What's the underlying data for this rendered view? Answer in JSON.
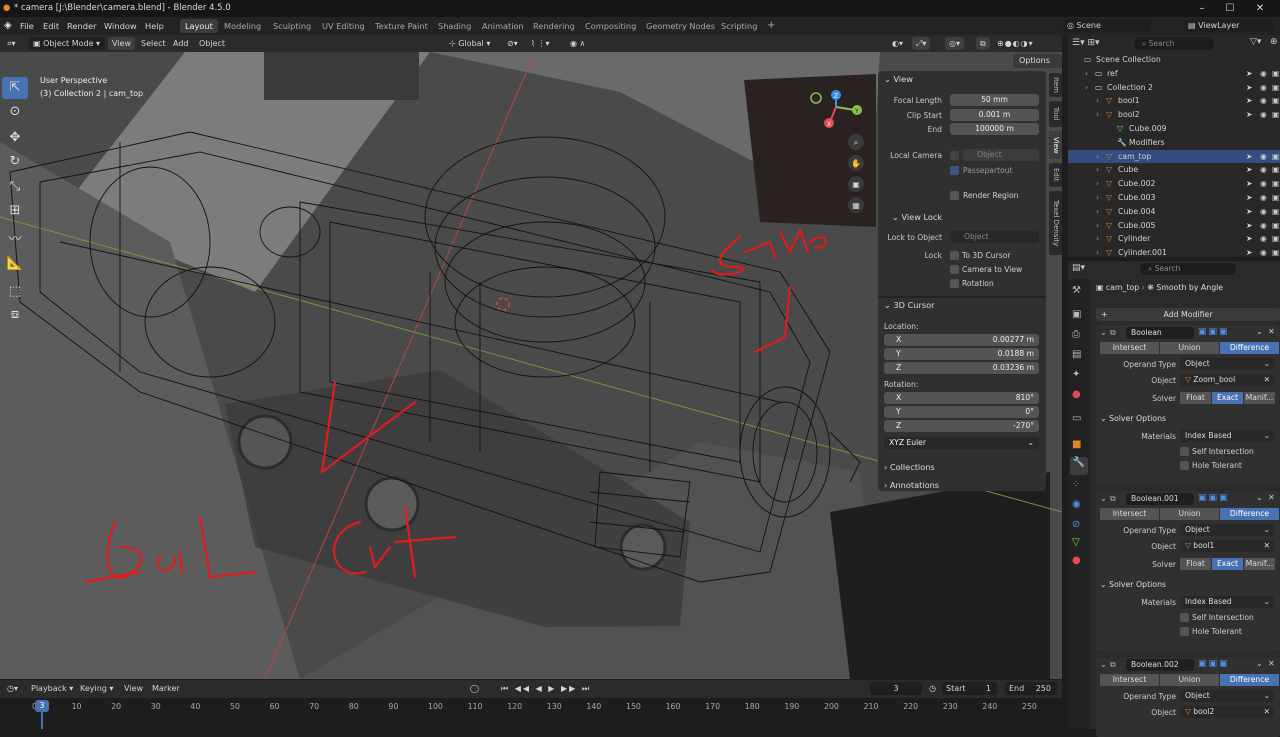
{
  "window": {
    "title": "* camera [J:\\Blender\\camera.blend] - Blender 4.5.0",
    "controls": [
      "–",
      "☐",
      "✕"
    ]
  },
  "menus": [
    "File",
    "Edit",
    "Render",
    "Window",
    "Help"
  ],
  "workspaces": [
    "Layout",
    "Modeling",
    "Sculpting",
    "UV Editing",
    "Texture Paint",
    "Shading",
    "Animation",
    "Rendering",
    "Compositing",
    "Geometry Nodes",
    "Scripting"
  ],
  "active_workspace": "Layout",
  "scene": {
    "name": "Scene",
    "view_layer": "ViewLayer"
  },
  "viewport_header": {
    "mode": "Object Mode",
    "items": [
      "View",
      "Select",
      "Add",
      "Object"
    ],
    "transform_orientation": "Global",
    "options_label": "Options"
  },
  "viewport": {
    "perspective": "User Perspective",
    "collection_info": "(3) Collection 2 | cam_top",
    "gizmo": {
      "x": "X",
      "y": "Y",
      "z": "Z"
    },
    "annotations": [
      "Same",
      "Boil",
      "Cut"
    ]
  },
  "npanel": {
    "tabs": [
      "Item",
      "Tool",
      "View",
      "Edit",
      "Texel Density"
    ],
    "active_tab": "View",
    "view": {
      "header": "View",
      "focal_length_label": "Focal Length",
      "focal_length": "50 mm",
      "clip_start_label": "Clip Start",
      "clip_start": "0.001 m",
      "end_label": "End",
      "clip_end": "100000 m",
      "local_camera_label": "Local Camera",
      "object_placeholder": "Object",
      "passepartout_label": "Passepartout",
      "render_region_label": "Render Region"
    },
    "view_lock": {
      "header": "View Lock",
      "lock_to_object_label": "Lock to Object",
      "object_placeholder": "Object",
      "lock_label": "Lock",
      "to_3d_cursor": "To 3D Cursor",
      "camera_to_view": "Camera to View",
      "rotation": "Rotation"
    },
    "cursor": {
      "header": "3D Cursor",
      "location_label": "Location:",
      "x": "0.00277 m",
      "y": "0.0188 m",
      "z": "0.03236 m",
      "rotation_label": "Rotation:",
      "rx": "810°",
      "ry": "0°",
      "rz": "-270°",
      "rotation_mode": "XYZ Euler"
    },
    "collections_label": "Collections",
    "annotations_label": "Annotations"
  },
  "outliner": {
    "search_placeholder": "Search",
    "items": [
      {
        "name": "Scene Collection",
        "indent": 0,
        "type": "collection-root"
      },
      {
        "name": "ref",
        "indent": 1,
        "type": "collection"
      },
      {
        "name": "Collection 2",
        "indent": 1,
        "type": "collection"
      },
      {
        "name": "bool1",
        "indent": 2,
        "type": "object"
      },
      {
        "name": "bool2",
        "indent": 2,
        "type": "object"
      },
      {
        "name": "Cube.009",
        "indent": 3,
        "type": "mesh"
      },
      {
        "name": "Modifiers",
        "indent": 3,
        "type": "modifiers"
      },
      {
        "name": "cam_top",
        "indent": 2,
        "type": "object",
        "selected": true
      },
      {
        "name": "Cube",
        "indent": 2,
        "type": "object"
      },
      {
        "name": "Cube.002",
        "indent": 2,
        "type": "object"
      },
      {
        "name": "Cube.003",
        "indent": 2,
        "type": "object"
      },
      {
        "name": "Cube.004",
        "indent": 2,
        "type": "object"
      },
      {
        "name": "Cube.005",
        "indent": 2,
        "type": "object"
      },
      {
        "name": "Cylinder",
        "indent": 2,
        "type": "object"
      },
      {
        "name": "Cylinder.001",
        "indent": 2,
        "type": "object"
      }
    ]
  },
  "properties": {
    "search_placeholder": "Search",
    "breadcrumb_object": "cam_top",
    "breadcrumb_modifier": "Smooth by Angle",
    "add_modifier_label": "Add Modifier",
    "modifiers": [
      {
        "name": "Boolean",
        "operation": "Difference",
        "operations": [
          "Intersect",
          "Union",
          "Difference"
        ],
        "operand_type_label": "Operand Type",
        "operand_type": "Object",
        "object_label": "Object",
        "object": "Zoom_bool",
        "solver_label": "Solver",
        "solvers": [
          "Float",
          "Exact",
          "Manif..."
        ],
        "solver": "Exact",
        "solver_options_label": "Solver Options",
        "materials_label": "Materials",
        "materials": "Index Based",
        "self_intersection": "Self Intersection",
        "hole_tolerant": "Hole Tolerant"
      },
      {
        "name": "Boolean.001",
        "operation": "Difference",
        "operations": [
          "Intersect",
          "Union",
          "Difference"
        ],
        "operand_type_label": "Operand Type",
        "operand_type": "Object",
        "object_label": "Object",
        "object": "bool1",
        "solver_label": "Solver",
        "solvers": [
          "Float",
          "Exact",
          "Manif..."
        ],
        "solver": "Exact",
        "solver_options_label": "Solver Options",
        "materials_label": "Materials",
        "materials": "Index Based",
        "self_intersection": "Self Intersection",
        "hole_tolerant": "Hole Tolerant"
      },
      {
        "name": "Boolean.002",
        "operation": "Difference",
        "operations": [
          "Intersect",
          "Union",
          "Difference"
        ],
        "operand_type_label": "Operand Type",
        "operand_type": "Object",
        "object_label": "Object",
        "object": "bool2"
      }
    ]
  },
  "timeline": {
    "menus": [
      "Playback",
      "Keying",
      "View",
      "Marker"
    ],
    "current_frame": "3",
    "start_label": "Start",
    "start": "1",
    "end_label": "End",
    "end": "250",
    "ticks": [
      "0",
      "10",
      "20",
      "30",
      "40",
      "50",
      "60",
      "70",
      "80",
      "90",
      "100",
      "110",
      "120",
      "130",
      "140",
      "150",
      "160",
      "170",
      "180",
      "190",
      "200",
      "210",
      "220",
      "230",
      "240",
      "250"
    ]
  },
  "colors": {
    "accent": "#4772b3",
    "annotation": "#e11b1b",
    "orange": "#e0862f",
    "green": "#7fcf5c",
    "x_axis": "#e74856",
    "y_axis": "#8bc24a",
    "z_axis": "#3b8ee8"
  }
}
